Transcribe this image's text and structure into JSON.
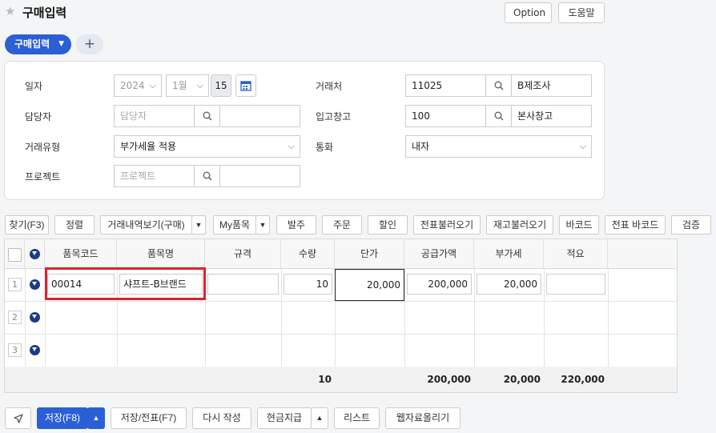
{
  "header": {
    "title": "구매입력",
    "option_label": "Option",
    "help_label": "도움말"
  },
  "tabs": {
    "active_label": "구매입력",
    "add_label": "+"
  },
  "form": {
    "date": {
      "label": "일자",
      "year": "2024",
      "month": "1월",
      "day": "15"
    },
    "vendor": {
      "label": "거래처",
      "code": "11025",
      "name": "B제조사"
    },
    "manager": {
      "label": "담당자",
      "placeholder": "담당자"
    },
    "warehouse": {
      "label": "입고창고",
      "code": "100",
      "name": "본사창고"
    },
    "trade_type": {
      "label": "거래유형",
      "value": "부가세율 적용"
    },
    "currency": {
      "label": "통화",
      "value": "내자"
    },
    "project": {
      "label": "프로젝트",
      "placeholder": "프로젝트"
    }
  },
  "toolbar": {
    "find": "찾기(F3)",
    "sort": "정렬",
    "history": "거래내역보기(구매)",
    "my_items": "My품목",
    "order": "발주",
    "purchase_order": "주문",
    "discount": "할인",
    "load_slip": "전표불러오기",
    "load_stock": "재고불러오기",
    "barcode": "바코드",
    "slip_barcode": "전표 바코드",
    "verify": "검증"
  },
  "grid": {
    "columns": [
      "품목코드",
      "품목명",
      "규격",
      "수량",
      "단가",
      "공급가액",
      "부가세",
      "적요"
    ],
    "rows": [
      {
        "num": "1",
        "code": "00014",
        "name": "샤프트-B브랜드",
        "spec": "",
        "qty": "10",
        "price": "20,000",
        "supply": "200,000",
        "vat": "20,000",
        "memo": ""
      },
      {
        "num": "2"
      },
      {
        "num": "3"
      }
    ],
    "totals": {
      "qty": "10",
      "supply": "200,000",
      "vat": "20,000",
      "total": "220,000"
    }
  },
  "bottom": {
    "save": "저장(F8)",
    "save_slip": "저장/전표(F7)",
    "rewrite": "다시 작성",
    "cash_pay": "현금지급",
    "list": "리스트",
    "upload": "웹자료올리기"
  },
  "colors": {
    "primary": "#2b5fd6",
    "highlight": "#e0202e"
  }
}
